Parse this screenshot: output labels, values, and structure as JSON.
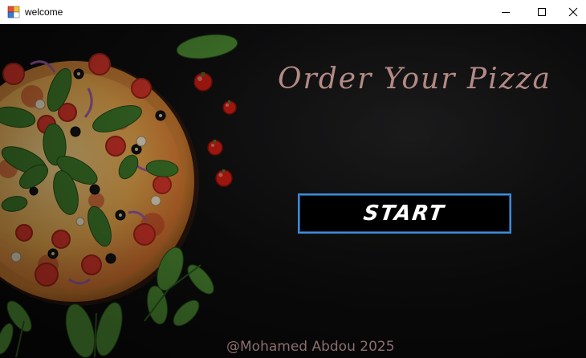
{
  "window": {
    "title": "welcome",
    "icon": "winforms-app-icon",
    "controls": {
      "minimize_icon": "minimize-icon",
      "maximize_icon": "maximize-icon",
      "close_icon": "close-icon"
    }
  },
  "main": {
    "heading": "Order Your Pizza",
    "start_label": "START",
    "footer": "@Mohamed Abdou 2025"
  },
  "colors": {
    "background": "#0b0b0c",
    "heading": "#b38a84",
    "button_border": "#3c8ddb",
    "button_text": "#ffffff",
    "footer": "#8a6f6b"
  }
}
